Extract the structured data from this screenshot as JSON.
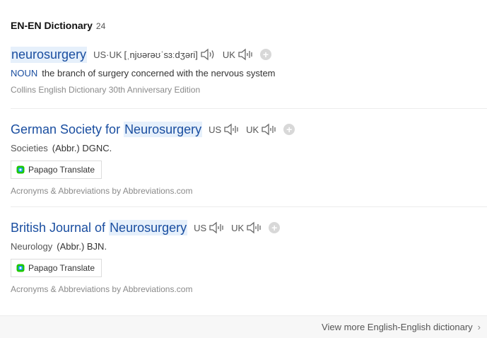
{
  "section": {
    "title": "EN-EN Dictionary",
    "count": "24"
  },
  "entries": [
    {
      "headword": "neurosurgery",
      "pron_us_label": "US·UK",
      "pron_ipa": "[ˌnjʊərəʊˈsɜːdʒəri]",
      "pron_uk_label": "UK",
      "pos": "NOUN",
      "definition": "the branch of surgery concerned with the nervous system",
      "source": "Collins English Dictionary 30th Anniversary Edition"
    },
    {
      "headword_prefix": "German Society for ",
      "headword_highlight": "Neurosurgery",
      "pron_us_label": "US",
      "pron_uk_label": "UK",
      "category": "Societies",
      "definition": "(Abbr.) DGNC.",
      "translate_label": "Papago Translate",
      "source": "Acronyms & Abbreviations by Abbreviations.com"
    },
    {
      "headword_prefix": "British Journal of ",
      "headword_highlight": "Neurosurgery",
      "pron_us_label": "US",
      "pron_uk_label": "UK",
      "category": "Neurology",
      "definition": "(Abbr.) BJN.",
      "translate_label": "Papago Translate",
      "source": "Acronyms & Abbreviations by Abbreviations.com"
    }
  ],
  "footer": {
    "more_label": "View more English-English dictionary"
  },
  "colors": {
    "link": "#1a4ea0",
    "highlight": "#e6f0fb",
    "muted": "#8a8a8a"
  },
  "icons": [
    "speaker-icon",
    "plus-icon",
    "papago-icon",
    "chevron-right-icon"
  ]
}
